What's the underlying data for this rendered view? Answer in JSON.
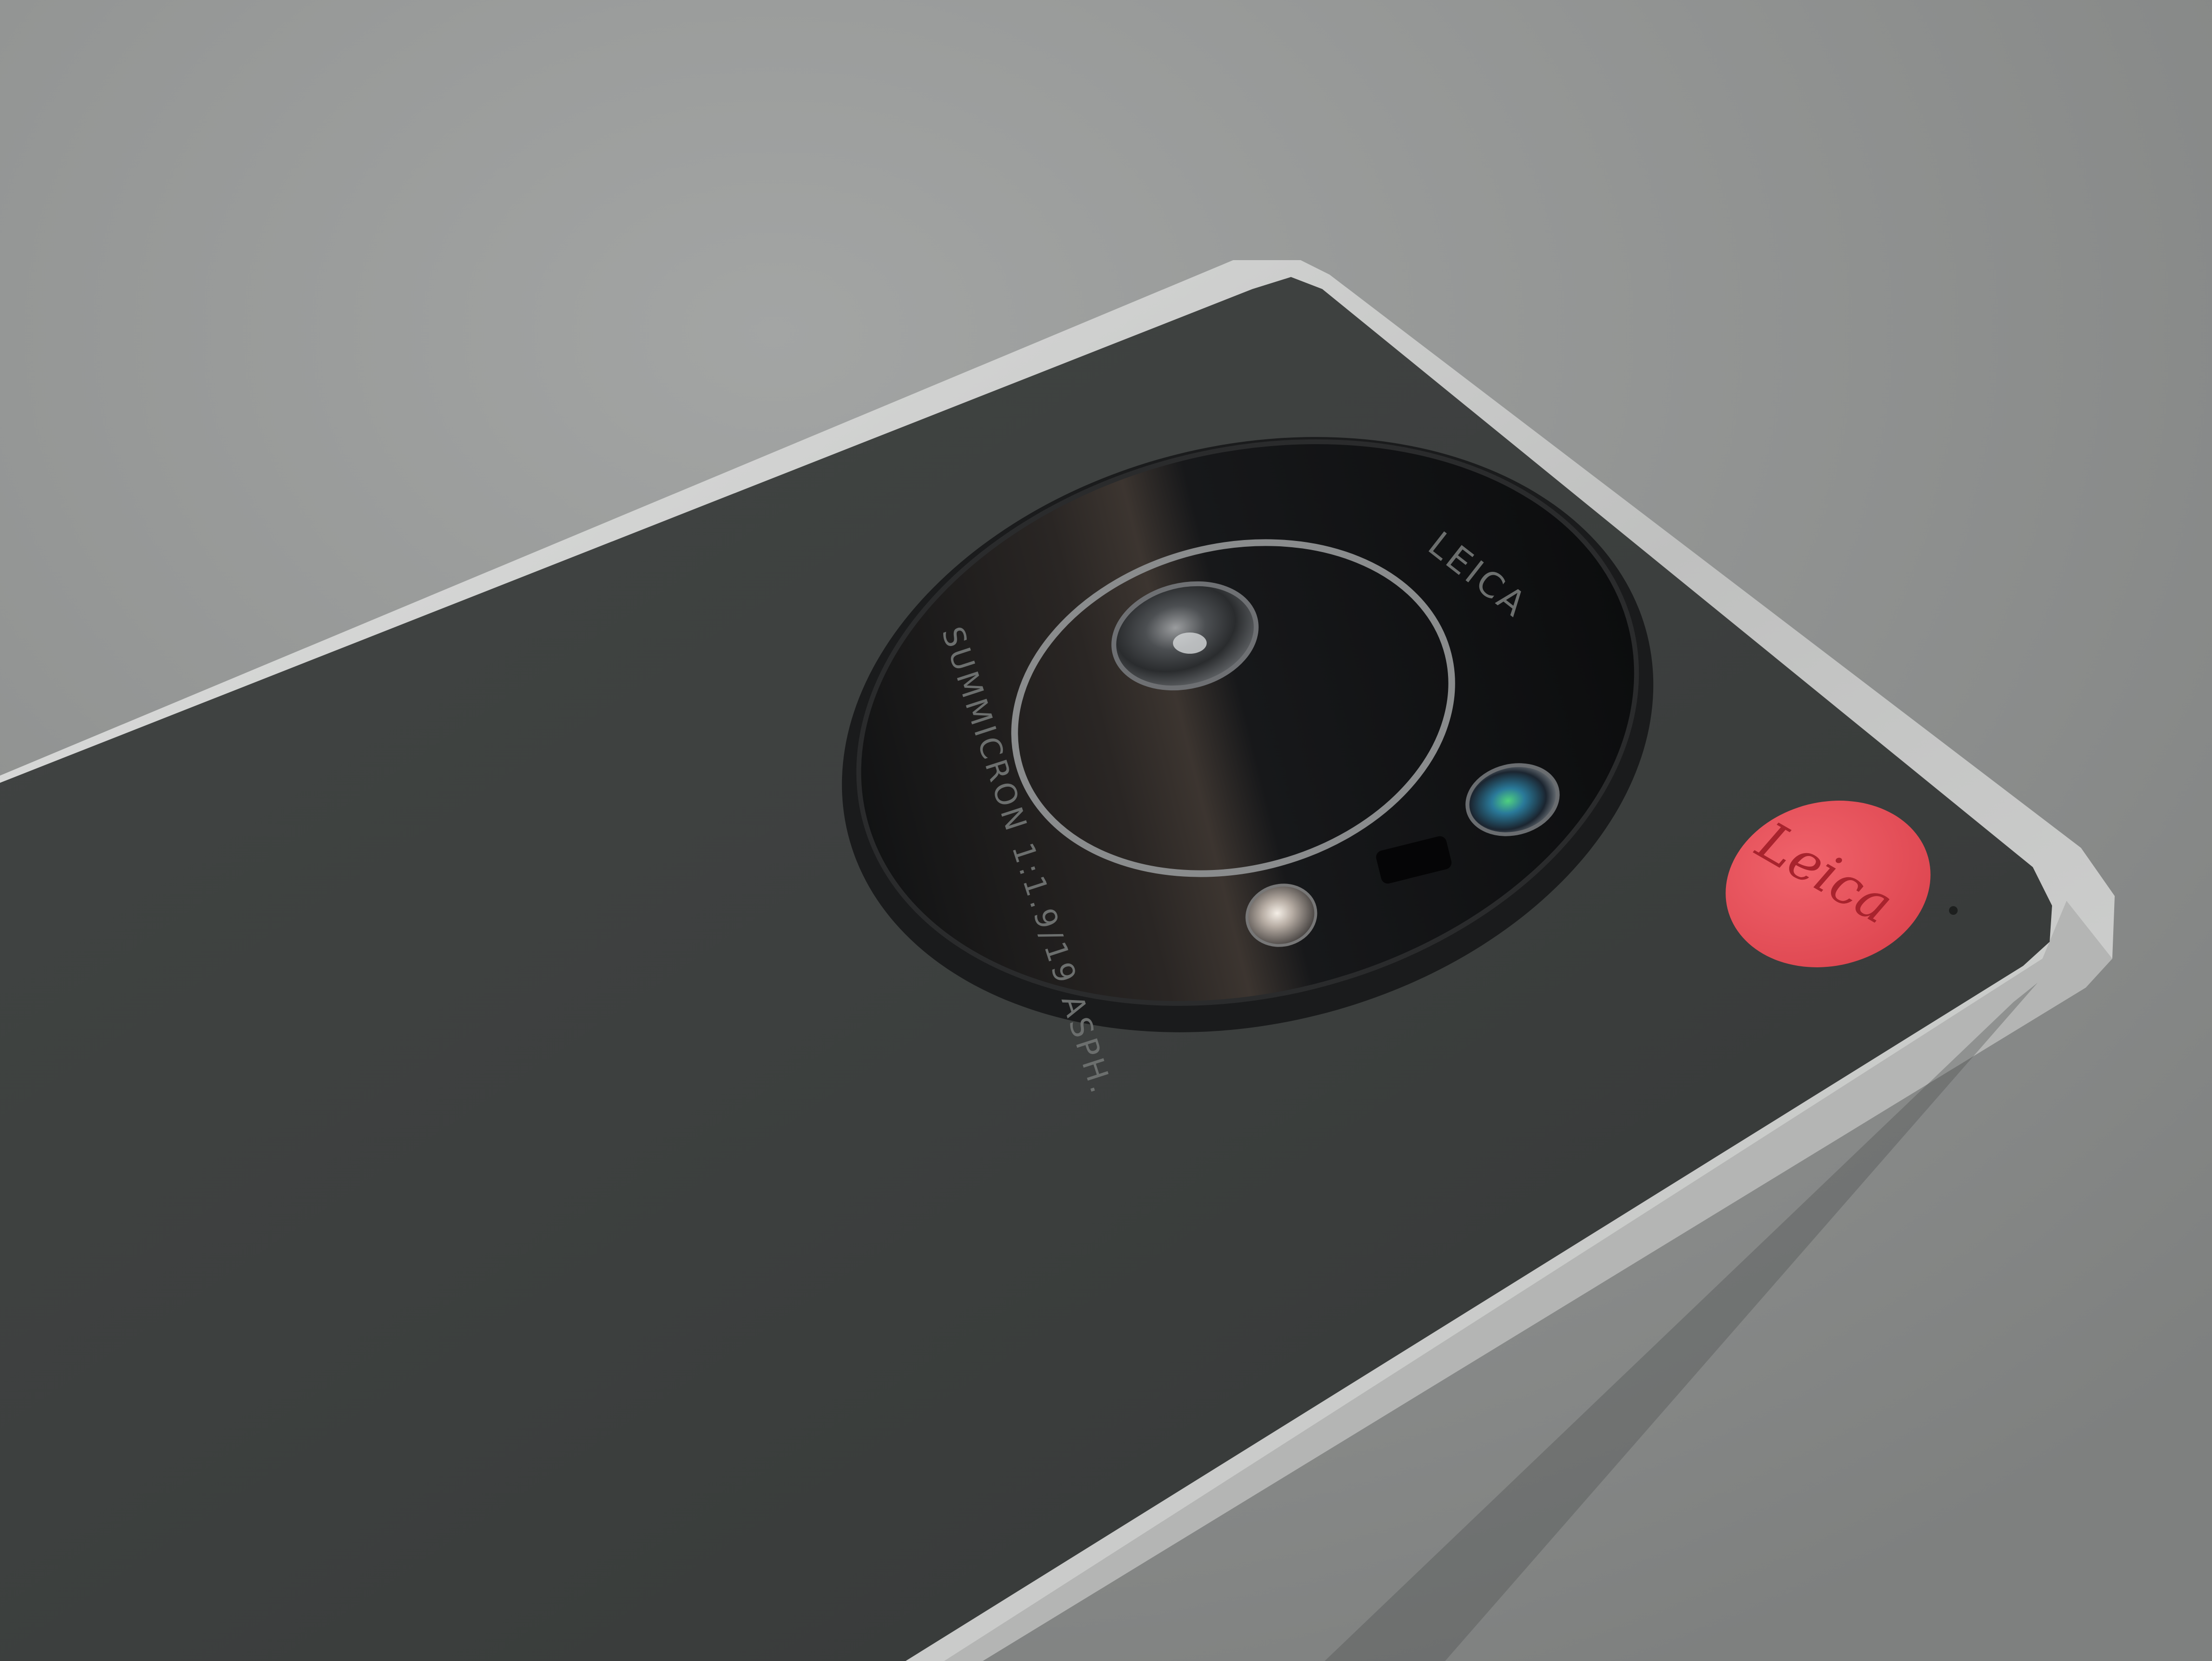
{
  "photo": {
    "subject": "smartphone-back",
    "colors": {
      "background": "#8e908f",
      "phone_body": "#3e4140",
      "frame_metal": "#c9cac9",
      "lens_ring": "#111213",
      "logo_dot": "#e8525a"
    }
  },
  "lens": {
    "brand_mark": "LEICA",
    "lens_name": "SUMMICRON 1:1.9/19 ASPH."
  },
  "logo": {
    "wordmark": "Leica"
  }
}
